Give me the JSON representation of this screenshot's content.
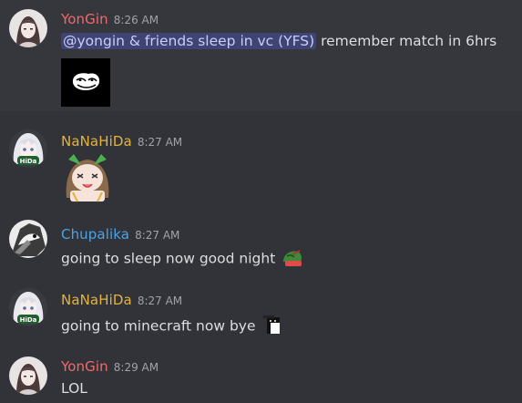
{
  "colors": {
    "background": "#313338",
    "highlight": "#36373d",
    "yongin_name": "#f06a6a",
    "nanahida_name": "#e3b341",
    "chupalika_name": "#4ba3e3",
    "mention_bg": "rgba(88,101,242,0.30)",
    "mention_text": "#c9cdfb"
  },
  "messages": [
    {
      "username": "YonGin",
      "timestamp": "8:26 AM",
      "mention": "@yongin & friends sleep in vc (YFS)",
      "text": " remember match in 6hrs",
      "attachment_icon": "troll-face-image"
    },
    {
      "username": "NaNaHiDa",
      "timestamp": "8:27 AM",
      "attachment_icon": "anime-girl-sticker",
      "avatar_badge": "HiDa"
    },
    {
      "username": "Chupalika",
      "timestamp": "8:27 AM",
      "text": "going to sleep now good night",
      "emoji_icon": "sleeping-pepe-emoji"
    },
    {
      "username": "NaNaHiDa",
      "timestamp": "8:27 AM",
      "text": "going to minecraft now bye",
      "emoji_icon": "cat-bye-emoji",
      "avatar_badge": "HiDa"
    },
    {
      "username": "YonGin",
      "timestamp": "8:29 AM",
      "text": "LOL"
    }
  ]
}
